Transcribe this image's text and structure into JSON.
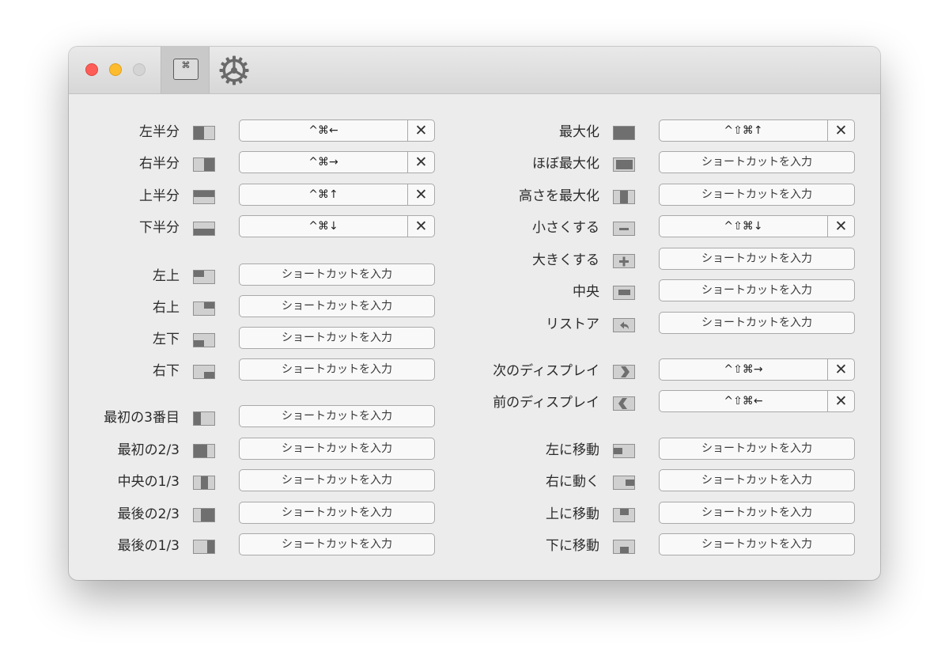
{
  "toolbar": {
    "tab_shortcuts_glyph": "⌘",
    "icons": [
      "keyboard-shortcuts-icon",
      "gear-icon"
    ]
  },
  "left": [
    {
      "label": "左半分",
      "icon": "left-half",
      "shortcut": "^⌘←"
    },
    {
      "label": "右半分",
      "icon": "right-half",
      "shortcut": "^⌘→"
    },
    {
      "label": "上半分",
      "icon": "top-half",
      "shortcut": "^⌘↑"
    },
    {
      "label": "下半分",
      "icon": "bottom-half",
      "shortcut": "^⌘↓"
    },
    {
      "label": "左上",
      "icon": "top-left",
      "shortcut": ""
    },
    {
      "label": "右上",
      "icon": "top-right",
      "shortcut": ""
    },
    {
      "label": "左下",
      "icon": "bottom-left",
      "shortcut": ""
    },
    {
      "label": "右下",
      "icon": "bottom-right",
      "shortcut": ""
    },
    {
      "label": "最初の3番目",
      "icon": "first-third",
      "shortcut": ""
    },
    {
      "label": "最初の2/3",
      "icon": "first-two-thirds",
      "shortcut": ""
    },
    {
      "label": "中央の1/3",
      "icon": "center-third",
      "shortcut": ""
    },
    {
      "label": "最後の2/3",
      "icon": "last-two-thirds",
      "shortcut": ""
    },
    {
      "label": "最後の1/3",
      "icon": "last-third",
      "shortcut": ""
    }
  ],
  "right": [
    {
      "label": "最大化",
      "icon": "maximize",
      "shortcut": "^⇧⌘↑"
    },
    {
      "label": "ほぼ最大化",
      "icon": "almost-maximize",
      "shortcut": ""
    },
    {
      "label": "高さを最大化",
      "icon": "maximize-height",
      "shortcut": ""
    },
    {
      "label": "小さくする",
      "icon": "make-smaller",
      "shortcut": "^⇧⌘↓"
    },
    {
      "label": "大きくする",
      "icon": "make-larger",
      "shortcut": ""
    },
    {
      "label": "中央",
      "icon": "center",
      "shortcut": ""
    },
    {
      "label": "リストア",
      "icon": "restore",
      "shortcut": ""
    },
    {
      "label": "次のディスプレイ",
      "icon": "next-display",
      "shortcut": "^⇧⌘→"
    },
    {
      "label": "前のディスプレイ",
      "icon": "previous-display",
      "shortcut": "^⇧⌘←"
    },
    {
      "label": "左に移動",
      "icon": "move-left",
      "shortcut": ""
    },
    {
      "label": "右に動く",
      "icon": "move-right",
      "shortcut": ""
    },
    {
      "label": "上に移動",
      "icon": "move-up",
      "shortcut": ""
    },
    {
      "label": "下に移動",
      "icon": "move-down",
      "shortcut": ""
    }
  ],
  "placeholder": "ショートカットを入力",
  "clear_glyph": "✕",
  "colors": {
    "close": "#fd5d56",
    "minimize": "#fdbc2e",
    "zoom": "#d4d4d4",
    "window_bg": "#ececec",
    "icon_fill": "#6f6f6f",
    "icon_bg": "#d0d0d0"
  }
}
